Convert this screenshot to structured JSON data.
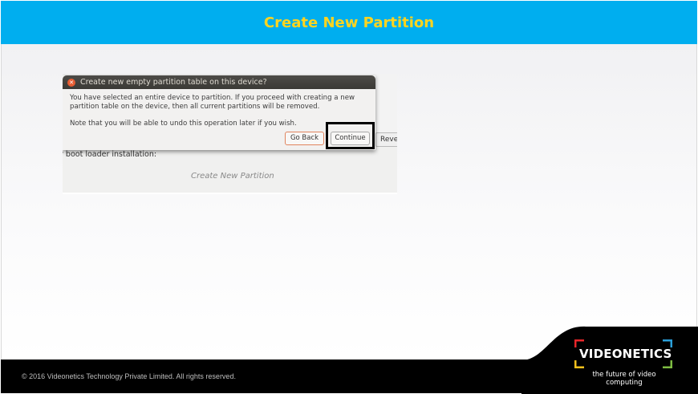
{
  "slide": {
    "title": "Create New Partition",
    "footer_text": "© 2016 Videonetics Technology Private Limited. All rights reserved."
  },
  "screenshot": {
    "dialog_title": "Create new empty partition table on this device?",
    "message": "You have selected an entire device to partition. If you proceed with creating a new partition table on the device, then all current partitions will be removed.",
    "note": "Note that you will be able to undo this operation later if you wish.",
    "go_back_label": "Go Back",
    "continue_label": "Continue",
    "revert_label": "Rever",
    "bootloader_label": "r boot loader installation:",
    "caption": "Create New Partition"
  },
  "logo": {
    "brand": "VIDEONETICS",
    "tagline": "the future of video computing"
  },
  "colors": {
    "title_bar": "#00aeef",
    "title_text": "#ffd41f",
    "footer": "#000000",
    "logo_corners": [
      "#e8262a",
      "#2b9fd9",
      "#f7c11b",
      "#7dbb42"
    ]
  },
  "icons": {
    "close": "close-icon"
  }
}
